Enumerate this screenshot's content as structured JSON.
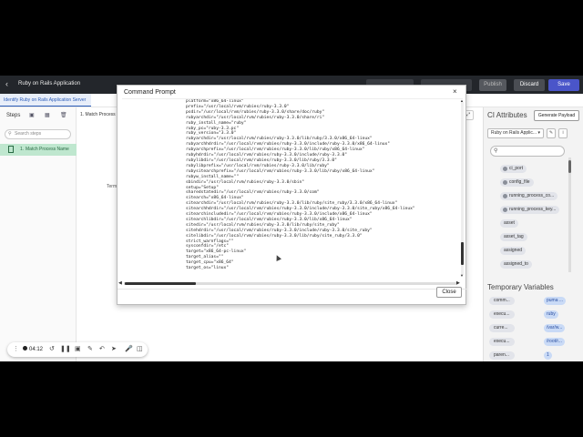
{
  "app": {
    "back_icon": "arrow-left-icon",
    "title": "Ruby on Rails Application",
    "ghost_button_1": "",
    "ghost_button_2": "",
    "publish": "Publish",
    "discard": "Discard",
    "save": "Save",
    "page_tab": "Identify Ruby on Rails Application Server",
    "colors": {
      "header": "#23262b",
      "save": "#4a55c9",
      "step_active": "#bfe7cf",
      "tag_value": "#c9daf6"
    }
  },
  "steps": {
    "heading": "Steps",
    "search_placeholder": "Search steps",
    "items": [
      {
        "number": "1.",
        "label": "Match Process Name"
      }
    ]
  },
  "main": {
    "step_title": "1. Match Process",
    "terminal_label": "Term"
  },
  "ci": {
    "title": "CI Attributes",
    "generate_button": "Generate Payload",
    "select_value": "Ruby on Rails Applic...",
    "attributes": [
      {
        "label": "ci_port",
        "tagged": true
      },
      {
        "label": "config_file",
        "tagged": true
      },
      {
        "label": "running_process_co...",
        "tagged": true
      },
      {
        "label": "running_process_key...",
        "tagged": true
      },
      {
        "label": "asset",
        "tagged": false
      },
      {
        "label": "asset_tag",
        "tagged": false
      },
      {
        "label": "assigned",
        "tagged": false
      },
      {
        "label": "assigned_to",
        "tagged": false
      }
    ]
  },
  "temp_vars": {
    "title": "Temporary Variables",
    "rows": [
      {
        "key": "comm...",
        "value": "puma ..."
      },
      {
        "key": "execu...",
        "value": "ruby"
      },
      {
        "key": "curre...",
        "value": "/var/w..."
      },
      {
        "key": "execu...",
        "value": "/root/r..."
      },
      {
        "key": "paren...",
        "value": "1"
      }
    ]
  },
  "dialog": {
    "title": "Command Prompt",
    "close_icon": "x-icon",
    "close_button": "Close",
    "lines": [
      "platform=\"x86_64-linux\"",
      "prefix=\"/usr/local/rvm/rubies/ruby-3.3.0\"",
      "psdir=\"/usr/local/rvm/rubies/ruby-3.3.0/share/doc/ruby\"",
      "rubyarchdir=\"/usr/local/rvm/rubies/ruby-3.3.0/share/ri\"",
      "ruby_install_name=\"ruby\"",
      "ruby_pc=\"ruby-3.3.pc\"",
      "ruby_version=\"3.3.0\"",
      "rubyarchdir=\"/usr/local/rvm/rubies/ruby-3.3.0/lib/ruby/3.3.0/x86_64-linux\"",
      "rubyarchhdrdir=\"/usr/local/rvm/rubies/ruby-3.3.0/include/ruby-3.3.0/x86_64-linux\"",
      "rubyarchprefix=\"/usr/local/rvm/rubies/ruby-3.3.0/lib/ruby/x86_64-linux\"",
      "rubyhdrdir=\"/usr/local/rvm/rubies/ruby-3.3.0/include/ruby-3.3.0\"",
      "rubylibdir=\"/usr/local/rvm/rubies/ruby-3.3.0/lib/ruby/3.3.0\"",
      "rubylibprefix=\"/usr/local/rvm/rubies/ruby-3.3.0/lib/ruby\"",
      "rubysitearchprefix=\"/usr/local/rvm/rubies/ruby-3.3.0/lib/ruby/x86_64-linux\"",
      "rubyw_install_name=\"\"",
      "sbindir=\"/usr/local/rvm/rubies/ruby-3.3.0/sbin\"",
      "setup=\"Setup\"",
      "sharedstatedir=\"/usr/local/rvm/rubies/ruby-3.3.0/com\"",
      "sitearch=\"x86_64-linux\"",
      "sitearchdir=\"/usr/local/rvm/rubies/ruby-3.3.0/lib/ruby/site_ruby/3.3.0/x86_64-linux\"",
      "sitearchhdrdir=\"/usr/local/rvm/rubies/ruby-3.3.0/include/ruby-3.3.0/site_ruby/x86_64-linux\"",
      "sitearchincludedir=\"/usr/local/rvm/rubies/ruby-3.3.0/include/x86_64-linux\"",
      "sitearchlibdir=\"/usr/local/rvm/rubies/ruby-3.3.0/lib/x86_64-linux\"",
      "sitedir=\"/usr/local/rvm/rubies/ruby-3.3.0/lib/ruby/site_ruby\"",
      "sitehdrdir=\"/usr/local/rvm/rubies/ruby-3.3.0/include/ruby-3.3.0/site_ruby\"",
      "sitelibdir=\"/usr/local/rvm/rubies/ruby-3.3.0/lib/ruby/site_ruby/3.3.0\"",
      "strict_warnflags=\"\"",
      "sysconfdir=\"/etc\"",
      "target=\"x86_64-pc-linux\"",
      "target_alias=\"\"",
      "target_cpu=\"x86_64\"",
      "target_os=\"linux\""
    ]
  },
  "recorder": {
    "time": "04:12",
    "icons": [
      "grip-icon",
      "restart-icon",
      "pause-icon",
      "stop-icon",
      "pen-icon",
      "undo-icon",
      "cursor-icon",
      "microphone-icon",
      "camera-icon"
    ]
  }
}
